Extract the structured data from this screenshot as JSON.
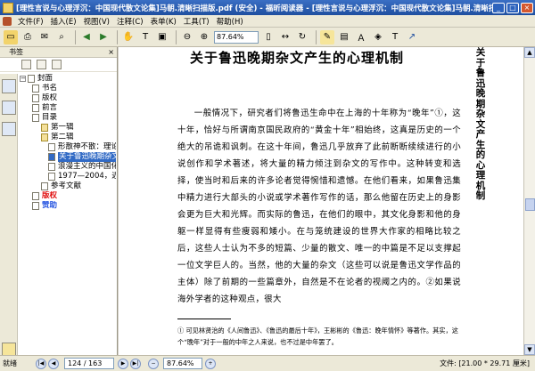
{
  "window": {
    "title": "[理性言说与心理浮沉：中国现代散文论集]马朝.清晰扫描版.pdf (安全) - 福昕阅读器 - [理性言说与心理浮沉：中国现代散文论集]马朝.清晰扫描版",
    "buttons": {
      "minimize": "_",
      "maximize": "□",
      "close": "×"
    }
  },
  "menubar": {
    "items": [
      "文件(F)",
      "插入(E)",
      "视图(V)",
      "注释(C)",
      "表单(K)",
      "工具(T)",
      "帮助(H)"
    ]
  },
  "toolbar": {
    "zoom": "87.64%"
  },
  "sidebar": {
    "header": "书签",
    "close": "×",
    "tree": [
      {
        "label": "封面",
        "level": 0,
        "kind": "page"
      },
      {
        "label": "书名",
        "level": 0,
        "kind": "page"
      },
      {
        "label": "版权",
        "level": 0,
        "kind": "page"
      },
      {
        "label": "前言",
        "level": 0,
        "kind": "page"
      },
      {
        "label": "目录",
        "level": 0,
        "kind": "page"
      },
      {
        "label": "第一辑",
        "level": 1,
        "kind": "folder"
      },
      {
        "label": "第二辑",
        "level": 1,
        "kind": "folder",
        "expanded": true
      },
      {
        "label": "形散神不散：理论",
        "level": 2,
        "kind": "page"
      },
      {
        "label": "关于鲁迅晚期杂文",
        "level": 2,
        "kind": "page",
        "selected": true
      },
      {
        "label": "浪漫主义的中国化",
        "level": 2,
        "kind": "page"
      },
      {
        "label": "1977—2004，近",
        "level": 2,
        "kind": "page"
      },
      {
        "label": "参考文献",
        "level": 1,
        "kind": "page"
      },
      {
        "label": "版权",
        "level": 0,
        "kind": "page",
        "style": "red"
      },
      {
        "label": "赞助",
        "level": 0,
        "kind": "page",
        "style": "blue"
      }
    ]
  },
  "document": {
    "title": "关于鲁迅晚期杂文产生的心理机制",
    "vertical_title": "关于鲁迅晚期杂文产生的心理机制",
    "paragraph": "一般情况下，研究者们将鲁迅生命中在上海的十年称为“晚年”①，这十年，恰好与所谓南京国民政府的“黄金十年”相始终，这真是历史的一个绝大的吊诡和讽刺。在这十年间，鲁迅几乎放弃了此前断断续续进行的小说创作和学术著述，将大量的精力倾注到杂文的写作中。这种转变和选择，使当时和后来的许多论者觉得惋惜和遗憾。在他们看来，如果鲁迅集中精力进行大部头的小说或学术著作写作的话，那么他留在历史上的身影会更为巨大和光辉。而实际的鲁迅，在他们的眼中，其文化身影和他的身躯一样显得有些瘦弱和矮小。在与笼统建设的世界大作家的相略比较之后，这些人士认为不多的短篇、少量的散文、唯一的中篇是不足以支撑起一位文学巨人的。当然，他的大量的杂文（这些可以说是鲁迅文学作品的主体）除了前期的一些篇章外，自然是不在论者的视阈之内的。②如果说海外学者的这种观点，很大",
    "footnote": "① 可见林贤治的《人间鲁迅》、《鲁迅的最后十年》，王彬彬的《鲁迅：晚年情怀》等著作。其实，这个“晚年”对于一般的中年之人来说，也不过是中年罢了。"
  },
  "statusbar": {
    "ready": "就绪",
    "page": "124 / 163",
    "zoom": "87.64%",
    "size": "文件: [21.00 * 29.71 厘米]"
  },
  "colors": {
    "titlebar": "#1f4fa0",
    "selected": "#316ac5",
    "red_link": "#e01010",
    "blue_link": "#2050e0"
  }
}
